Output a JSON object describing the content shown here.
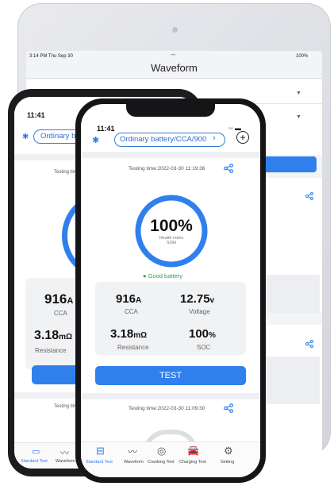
{
  "tablet": {
    "status_left": "3:14 PM  Thu Sep 30",
    "status_dots": "•••",
    "status_right": "100%",
    "title": "Waveform"
  },
  "android": {
    "time": "11:41",
    "battery_pill": "Ordinary battery/CCA/900",
    "testing_time": "Testing time:2022-03-30 11:19:36",
    "cca_value": "916",
    "cca_unit": "A",
    "cca_label": "CCA",
    "resistance_value": "3.18",
    "resistance_unit": "mΩ",
    "resistance_label": "Resistance",
    "test_button": "TEST",
    "second_testing_time": "Testing time:2022-03-30 11:09:30",
    "nav": [
      "Standard Test",
      "Waveform"
    ]
  },
  "iphone": {
    "time": "11:41",
    "battery_pill": "Ordinary battery/CCA/900",
    "testing_time": "Testing time:2022-03-30 11:19:36",
    "health_percent": "100%",
    "health_label": "Health index",
    "health_sublabel": "SOH",
    "health_value": 1.0,
    "status_text": "Good battery",
    "cca_value": "916",
    "cca_unit": "A",
    "cca_label": "CCA",
    "voltage_value": "12.75",
    "voltage_unit": "v",
    "voltage_label": "Voltage",
    "resistance_value": "3.18",
    "resistance_unit": "mΩ",
    "resistance_label": "Resistance",
    "soc_value": "100",
    "soc_unit": "%",
    "soc_label": "SOC",
    "test_button": "TEST",
    "second_testing_time": "Testing time:2022-03-30 11:09:30",
    "nav": [
      "Standard Test",
      "Waveform",
      "Cranking Test",
      "Charging Test",
      "Setting"
    ]
  },
  "colors": {
    "accent": "#2f80ed",
    "good": "#2aa44f"
  }
}
